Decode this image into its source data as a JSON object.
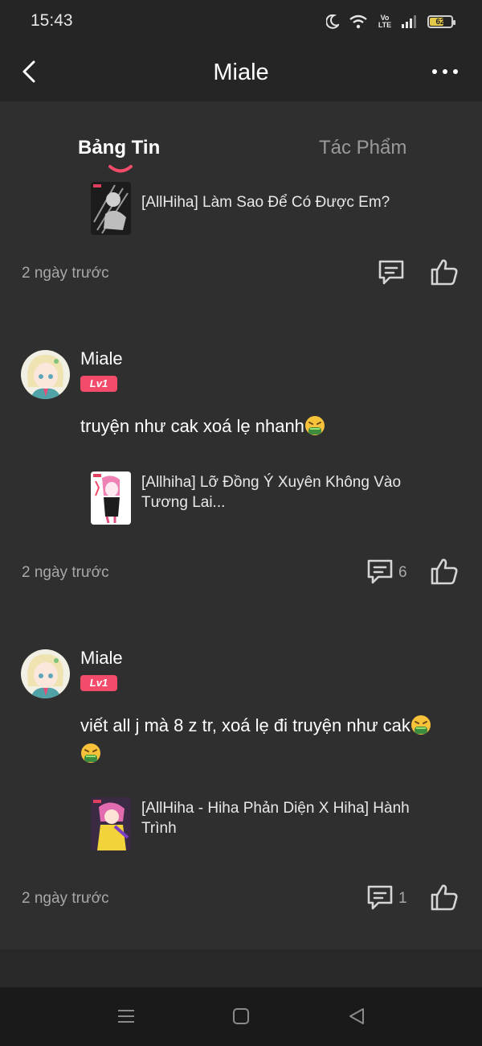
{
  "status_bar": {
    "time": "15:43",
    "network": "Vo LTE",
    "battery": "62",
    "icons": [
      "moon-icon",
      "wifi-icon",
      "volte-icon",
      "signal-icon",
      "battery-icon"
    ]
  },
  "nav": {
    "title": "Miale",
    "back_icon": "chevron-left-icon",
    "more_icon": "more-dots-icon"
  },
  "tabs": [
    {
      "label": "Bảng Tin",
      "active": true
    },
    {
      "label": "Tác Phẩm",
      "active": false
    }
  ],
  "posts": [
    {
      "work_title": "[AllHiha] Làm Sao Để Có Được Em?",
      "timestamp": "2 ngày trước"
    },
    {
      "author": "Miale",
      "level": "Lv1",
      "text": "truyện như cak xoá lẹ nhanh",
      "work_title": "[Allhiha] Lỡ Đồng Ý Xuyên Không Vào Tương Lai...",
      "timestamp": "2 ngày trước",
      "comments": "6"
    },
    {
      "author": "Miale",
      "level": "Lv1",
      "text": "viết all j mà 8 z tr, xoá lẹ đi truyện như cak",
      "work_title": "[AllHiha - Hiha Phản Diện X Hiha] Hành Trình",
      "timestamp": "2 ngày trước",
      "comments": "1"
    }
  ],
  "colors": {
    "background": "#2f2f2f",
    "bar_background": "#252525",
    "accent": "#f24c6a",
    "muted_text": "#a8a8a8"
  }
}
